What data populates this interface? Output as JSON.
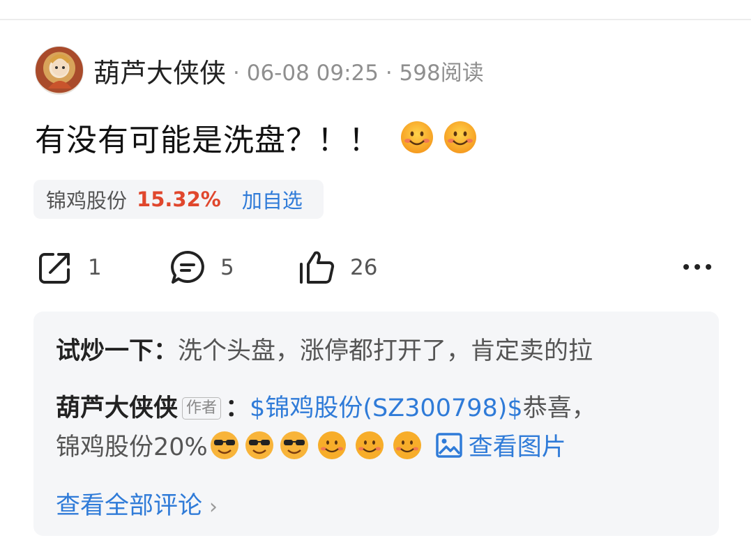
{
  "post": {
    "author": "葫芦大侠侠",
    "meta": "· 06-08 09:25 · 598阅读",
    "text": "有没有可能是洗盘？！！",
    "emojis": [
      "smile-emoji",
      "smile-emoji"
    ]
  },
  "stock": {
    "name": "锦鸡股份",
    "change": "15.32%",
    "add_label": "加自选",
    "change_color": "#e0472d"
  },
  "actions": {
    "share_count": "1",
    "comment_count": "5",
    "like_count": "26"
  },
  "comments": {
    "c1": {
      "user": "试炒一下",
      "sep": "：",
      "text": "洗个头盘，涨停都打开了，肯定卖的拉"
    },
    "c2": {
      "user": "葫芦大侠侠",
      "author_tag": "作者",
      "sep": "：",
      "link": "$锦鸡股份(SZ300798)$",
      "text_a": "恭喜，",
      "text_b": "锦鸡股份20%",
      "emojis": [
        "cool-emoji",
        "cool-emoji",
        "cool-emoji",
        "smile-emoji",
        "smile-emoji",
        "smile-emoji"
      ],
      "view_image": "查看图片"
    },
    "view_all": "查看全部评论",
    "chevron": "›"
  },
  "colors": {
    "link": "#2f7bd8",
    "chip_bg": "#f4f5f7",
    "comment_bg": "#f5f6f8"
  }
}
